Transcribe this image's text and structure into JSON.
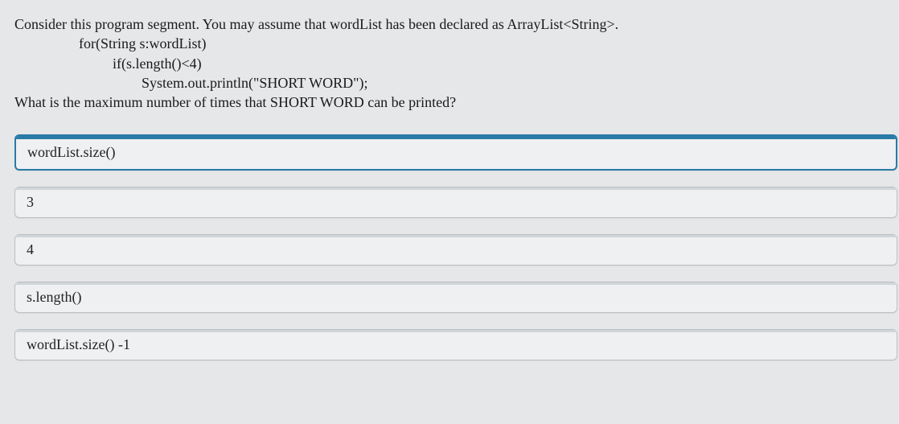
{
  "question": {
    "line1": "Consider this program segment. You may assume that wordList has been declared as ArrayList<String>.",
    "line2": "for(String s:wordList)",
    "line3": "if(s.length()<4)",
    "line4": "System.out.println(\"SHORT WORD\");",
    "line5": "What is the maximum number of times that SHORT WORD can be printed?"
  },
  "options": [
    {
      "label": "wordList.size()",
      "selected": true
    },
    {
      "label": "3",
      "selected": false
    },
    {
      "label": "4",
      "selected": false
    },
    {
      "label": "s.length()",
      "selected": false
    },
    {
      "label": "wordList.size() -1",
      "selected": false
    }
  ]
}
